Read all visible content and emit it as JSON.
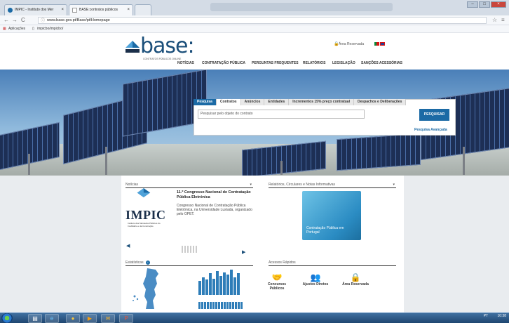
{
  "browser": {
    "tabs": [
      {
        "label": "IMPIC - Instituto dos Mer",
        "active": false
      },
      {
        "label": "BASE:contratos públicos",
        "active": true
      }
    ],
    "url": "www.base.gov.pt/Base/pt/Homepage",
    "bookmarks": [
      "Aplicações",
      "impicbo/impicbo/"
    ]
  },
  "header": {
    "logo_text": "base:",
    "logo_sub": "CONTRATOS PÚBLICOS ONLINE",
    "area_reservada": "Área Reservada",
    "nav": [
      "NOTÍCIAS",
      "CONTRATAÇÃO PÚBLICA",
      "PERGUNTAS FREQUENTES",
      "RELATÓRIOS",
      "LEGISLAÇÃO",
      "SANÇÕES ACESSÓRIAS"
    ]
  },
  "search": {
    "tabs": [
      "Pesquisa",
      "Contratos",
      "Anúncios",
      "Entidades",
      "Incrementos 15% preço contratual",
      "Despachos e Deliberações"
    ],
    "placeholder": "Pesquisar pelo objeto do contrato",
    "button": "PESQUISAR",
    "advanced": "Pesquisa Avançada"
  },
  "sections": {
    "noticias": "Notícias",
    "relatorios": "Relatórios, Circulares e Notas Informativas",
    "estatisticas": "Estatísticas",
    "acessos": "Acessos Rápidos"
  },
  "news": {
    "title": "11.º Congresso Nacional de Contratação Pública Eletrónica",
    "body": "Congresso Nacional de Contratação Pública Eletrónica, na Universidade Lusíada, organizado pelo OPET.",
    "impic_word": "IMPIC",
    "impic_caption": "Instituto dos Mercados Públicos do Imobiliário e da Construção"
  },
  "report": {
    "book_text": "Contratação Pública em Portugal"
  },
  "quick_access": [
    {
      "label": "Concursos Públicos",
      "icon": "handshake-icon"
    },
    {
      "label": "Ajustes Diretos",
      "icon": "people-icon"
    },
    {
      "label": "Área Reservada",
      "icon": "lock-icon"
    }
  ],
  "tray": {
    "lang": "PT",
    "time": "10:38"
  },
  "colors": {
    "brand": "#1b4f7a",
    "accent": "#1b6aa5"
  },
  "stats_bars": [
    0.55,
    0.7,
    0.6,
    0.85,
    0.65,
    0.95,
    0.75,
    0.9,
    0.8,
    1.0,
    0.7,
    0.85
  ]
}
